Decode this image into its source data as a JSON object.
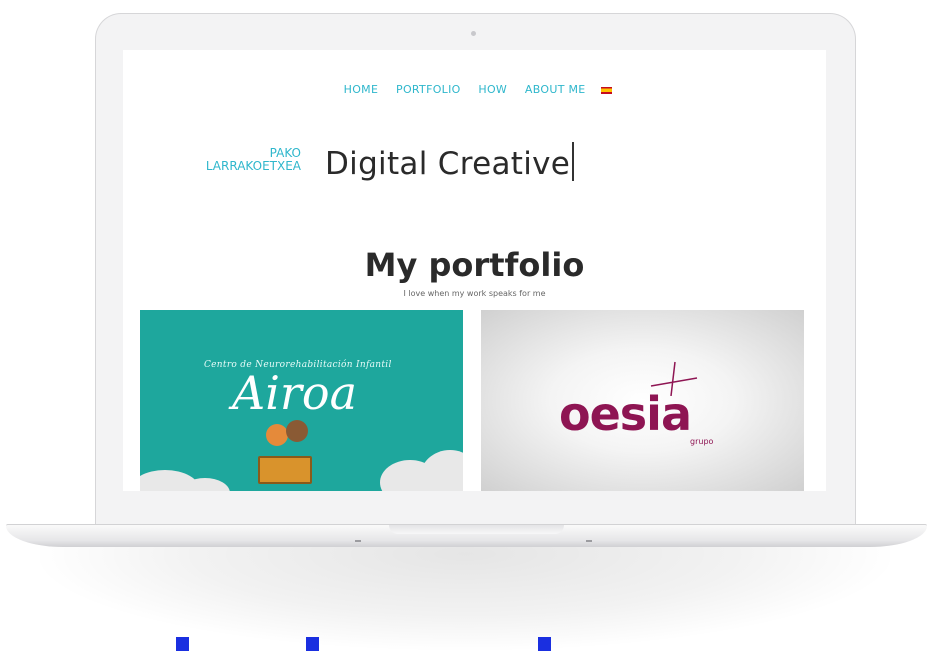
{
  "nav": {
    "items": [
      "HOME",
      "PORTFOLIO",
      "HOW",
      "ABOUT ME"
    ],
    "language_flag": "es-flag-icon"
  },
  "brand": {
    "line1": "PAKO",
    "line2": "LARRAKOETXEA"
  },
  "hero": {
    "headline": "Digital Creative"
  },
  "portfolio": {
    "title": "My portfolio",
    "subtitle": "I love when my work speaks for me",
    "projects": [
      {
        "caption": "Centro de Neurorehabilitación Infantil",
        "logo_text": "Airoa",
        "background": "#1ea79d"
      },
      {
        "logo_text": "oesia",
        "logo_sub": "grupo",
        "logo_color": "#8e1553"
      }
    ]
  },
  "colors": {
    "accent": "#2fb7cc",
    "text": "#2a2a2a"
  }
}
